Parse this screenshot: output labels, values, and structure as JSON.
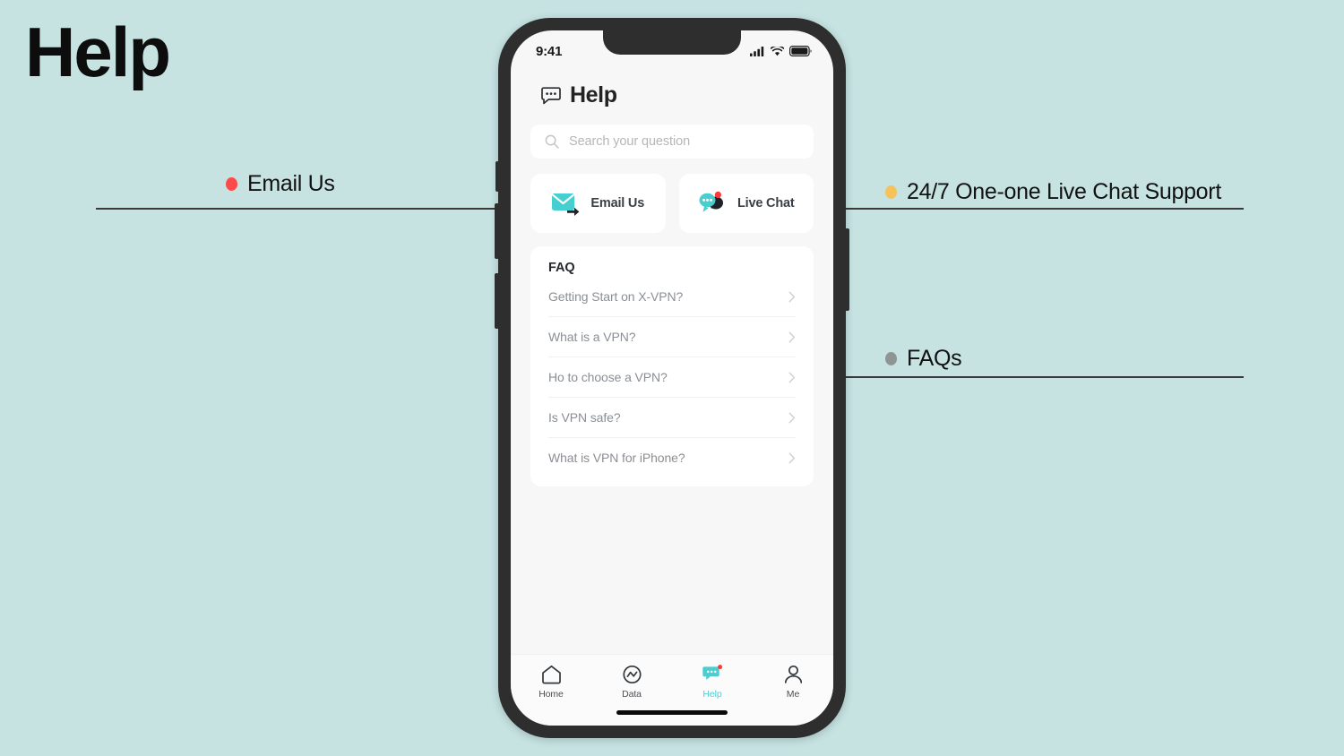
{
  "page": {
    "heading": "Help",
    "background_color": "#c6e3e2"
  },
  "annotations": [
    {
      "id": "email-us",
      "label": "Email Us",
      "dot_color": "#fb4a4a",
      "side": "left"
    },
    {
      "id": "live-chat",
      "label": "24/7 One-one Live Chat Support",
      "dot_color": "#f5c359",
      "side": "right"
    },
    {
      "id": "faqs",
      "label": "FAQs",
      "dot_color": "#8f9594",
      "side": "right"
    }
  ],
  "phone": {
    "status_bar": {
      "time": "9:41",
      "icons": [
        "signal-icon",
        "wifi-icon",
        "battery-icon"
      ]
    },
    "app": {
      "title": "Help",
      "title_icon": "chat-bubble-icon",
      "search": {
        "placeholder": "Search your question",
        "value": "",
        "icon": "search-icon"
      },
      "actions": [
        {
          "label": "Email Us",
          "icon": "email-send-icon"
        },
        {
          "label": "Live Chat",
          "icon": "live-chat-icon",
          "badge": true
        }
      ],
      "faq": {
        "title": "FAQ",
        "items": [
          "Getting Start on X-VPN?",
          "What is a VPN?",
          "Ho to choose a VPN?",
          "Is VPN safe?",
          "What is VPN for iPhone?"
        ],
        "chevron_icon": "chevron-right-icon"
      },
      "tabs": [
        {
          "label": "Home",
          "icon": "home-icon",
          "active": false
        },
        {
          "label": "Data",
          "icon": "data-chart-icon",
          "active": false
        },
        {
          "label": "Help",
          "icon": "chat-bubble-icon",
          "active": true,
          "badge": true
        },
        {
          "label": "Me",
          "icon": "person-icon",
          "active": false
        }
      ],
      "accent_color": "#4ecdcf",
      "badge_color": "#fb3b3b"
    }
  }
}
